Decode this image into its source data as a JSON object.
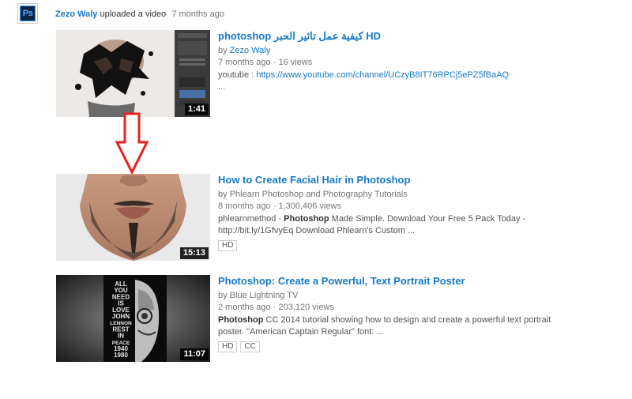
{
  "header": {
    "logo_text": "Ps",
    "uploader": "Zezo Waly",
    "action": "uploaded a video",
    "time": "7 months ago"
  },
  "videos": [
    {
      "title": "photoshop كيفية عمل تاثير الحبر HD",
      "by_prefix": "by",
      "channel": "Zezo Waly",
      "age": "7 months ago",
      "views": "16 views",
      "desc_prefix": "youtube : ",
      "desc_link": "https://www.youtube.com/channel/UCzyB8IT76RPCj5ePZ5fBaAQ",
      "desc_more": "...",
      "duration": "1:41",
      "badges": []
    },
    {
      "title": "How to Create Facial Hair in Photoshop",
      "by_prefix": "by",
      "channel": "Phlearn Photoshop and Photography Tutorials",
      "age": "8 months ago",
      "views": "1,300,406 views",
      "desc_line1_a": "phlearnmethod - ",
      "desc_line1_bold": "Photoshop",
      "desc_line1_b": " Made Simple. Download Your Free 5 Pack Today -",
      "desc_line2": "http://bit.ly/1GfvyEq Download Phlearn's Custom ...",
      "duration": "15:13",
      "badges": [
        "HD"
      ]
    },
    {
      "title": "Photoshop: Create a Powerful, Text Portrait Poster",
      "by_prefix": "by",
      "channel": "Blue Lightning TV",
      "age": "2 months ago",
      "views": "203,120 views",
      "desc_line1_bold": "Photoshop",
      "desc_line1_b": " CC 2014 tutorial showing how to design and create a powerful text portrait",
      "desc_line2": "poster. \"American Captain Regular\" font: ...",
      "duration": "11:07",
      "badges": [
        "HD",
        "CC"
      ]
    }
  ],
  "meta_separator": "·",
  "poster_words": [
    "ALL",
    "YOU",
    "NEED",
    "IS",
    "LOVE",
    "JOHN",
    "LENNON",
    "REST",
    "IN",
    "PEACE",
    "1940",
    "1980"
  ],
  "colors": {
    "link": "#167ac6",
    "meta": "#767676",
    "arrow": "#e8231d",
    "ps_blue": "#2fa3ff",
    "ps_dark": "#0c2348"
  }
}
